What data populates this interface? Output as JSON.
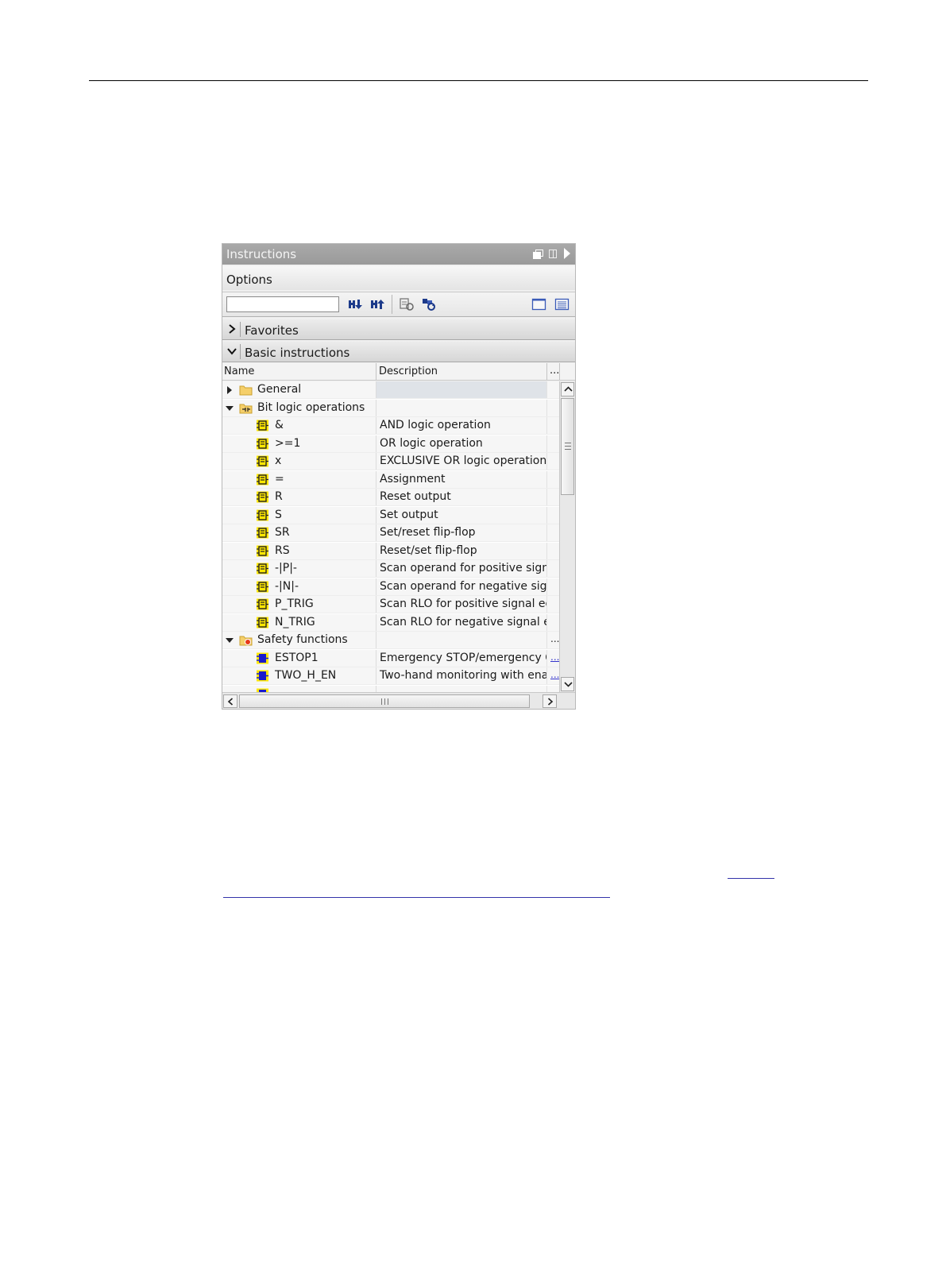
{
  "panel": {
    "title": "Instructions",
    "options_label": "Options",
    "search": {
      "value": "",
      "placeholder": ""
    },
    "sections": {
      "favorites": "Favorites",
      "basic": "Basic instructions"
    },
    "columns": {
      "name": "Name",
      "description": "Description",
      "more": "..."
    },
    "rows": [
      {
        "name": "General",
        "description": "",
        "more": ""
      },
      {
        "name": "Bit logic operations",
        "description": "",
        "more": ""
      },
      {
        "name": "&",
        "description": "AND logic operation",
        "more": ""
      },
      {
        "name": ">=1",
        "description": "OR logic operation",
        "more": ""
      },
      {
        "name": "x",
        "description": "EXCLUSIVE OR logic operation",
        "more": ""
      },
      {
        "name": "=",
        "description": "Assignment",
        "more": ""
      },
      {
        "name": "R",
        "description": "Reset output",
        "more": ""
      },
      {
        "name": "S",
        "description": "Set output",
        "more": ""
      },
      {
        "name": "SR",
        "description": "Set/reset flip-flop",
        "more": ""
      },
      {
        "name": "RS",
        "description": "Reset/set flip-flop",
        "more": ""
      },
      {
        "name": "-|P|-",
        "description": "Scan operand for positive sign...",
        "more": ""
      },
      {
        "name": "-|N|-",
        "description": "Scan operand for negative sign.",
        "more": ""
      },
      {
        "name": "P_TRIG",
        "description": "Scan RLO for positive signal ed..",
        "more": ""
      },
      {
        "name": "N_TRIG",
        "description": "Scan RLO for negative signal e..",
        "more": ""
      },
      {
        "name": "Safety functions",
        "description": "",
        "more": "..."
      },
      {
        "name": "ESTOP1",
        "description": "Emergency STOP/emergency O.",
        "more": "..."
      },
      {
        "name": "TWO_H_EN",
        "description": "Two-hand monitoring with ena..",
        "more": "..."
      }
    ]
  },
  "icons": {
    "title_buttons": [
      "restore-icon",
      "split-icon",
      "play-icon"
    ],
    "toolbar": [
      "search-down-icon",
      "search-up-icon",
      "reset-icon",
      "refresh-icon",
      "single-view-icon",
      "list-view-icon"
    ]
  },
  "colors": {
    "accent": "#0000cc",
    "instruction_icon": "#ffe800",
    "safety_icon": "#1a1acc"
  }
}
